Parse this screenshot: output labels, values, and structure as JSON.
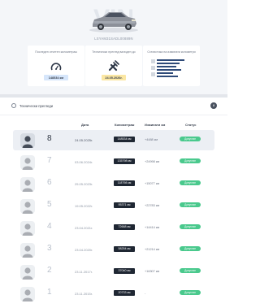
{
  "vehicle": {
    "vin": "LSYAM31SADL00889N"
  },
  "cards": [
    {
      "title": "Последен отчетен километраж",
      "value": "148534 км",
      "icon": "speedometer-icon"
    },
    {
      "title": "Технически преглед валиден до",
      "value": "24.05.2026г.",
      "icon": "wrench-icon"
    },
    {
      "title": "Статистика на изминати километри",
      "value": "",
      "icon": "bar-stats-icon"
    }
  ],
  "section": {
    "title": "Технически прегледи",
    "count": "8",
    "icon": "clock-icon"
  },
  "table": {
    "headers": [
      "Дата",
      "Километраж",
      "Изминати км",
      "Статус"
    ],
    "rows": [
      {
        "num": "8",
        "date": "24.05.2025г.",
        "km": "148534 км",
        "diff": "+4488 км",
        "status": "Допуснат"
      },
      {
        "num": "7",
        "date": "03.06.2024г.",
        "km": "135798 км",
        "diff": "+24998 км",
        "status": "Допуснат"
      },
      {
        "num": "6",
        "date": "25.05.2023г.",
        "km": "118798 км",
        "diff": "+15077 км",
        "status": "Допуснат"
      },
      {
        "num": "5",
        "date": "19.05.2022г.",
        "km": "95371 км",
        "diff": "+22783 км",
        "status": "Допуснат"
      },
      {
        "num": "4",
        "date": "23.04.2021г.",
        "km": "72668 км",
        "diff": "+14414 км",
        "status": "Допуснат"
      },
      {
        "num": "3",
        "date": "23.04.2020г.",
        "km": "58254 км",
        "diff": "+21214 км",
        "status": "Допуснат"
      },
      {
        "num": "2",
        "date": "23.11.2017г.",
        "km": "37040 км",
        "diff": "+16307 км",
        "status": "Допуснат"
      },
      {
        "num": "1",
        "date": "23.11.2015г.",
        "km": "20733 км",
        "diff": "-",
        "status": "Допуснат"
      }
    ]
  },
  "colors": {
    "status_green": "#4ac98d",
    "km_badge": "#1f2733",
    "value_blue": "#d6e6fb",
    "value_yellow": "#fbe7a3"
  }
}
